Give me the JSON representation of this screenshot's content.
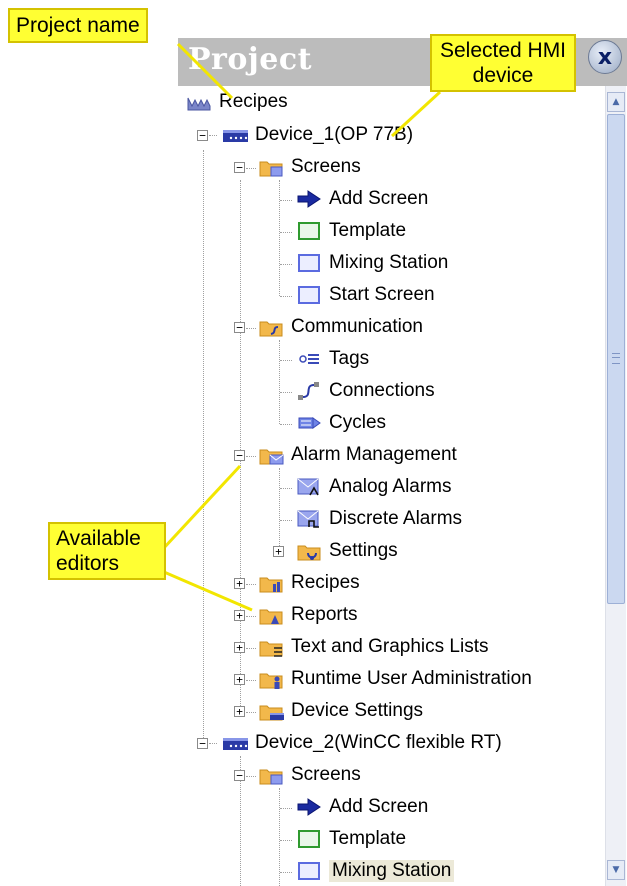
{
  "panel": {
    "title": "Project",
    "close_symbol": "x"
  },
  "scrollbar": {
    "up_glyph": "▲",
    "down_glyph": "▼"
  },
  "callouts": {
    "project_name": "Project name",
    "selected_device": "Selected HMI device",
    "available_editors": "Available editors"
  },
  "tree": {
    "root": "Recipes",
    "device1": {
      "label": "Device_1(OP 77B)",
      "screens": "Screens",
      "add_screen": "Add Screen",
      "template": "Template",
      "mixing_station": "Mixing Station",
      "start_screen": "Start Screen",
      "communication": "Communication",
      "tags": "Tags",
      "connections": "Connections",
      "cycles": "Cycles",
      "alarm_management": "Alarm Management",
      "analog_alarms": "Analog Alarms",
      "discrete_alarms": "Discrete Alarms",
      "settings": "Settings",
      "recipes": "Recipes",
      "reports": "Reports",
      "text_graphics": "Text and Graphics Lists",
      "runtime_user_admin": "Runtime User Administration",
      "device_settings": "Device Settings"
    },
    "device2": {
      "label": "Device_2(WinCC flexible RT)",
      "screens": "Screens",
      "add_screen": "Add Screen",
      "template": "Template",
      "mixing_station": "Mixing Station"
    },
    "expander_plus": "+",
    "expander_minus": "−"
  },
  "colors": {
    "callout": "#ffff33",
    "titlebar": "#bcbcbc",
    "folder": "#f2b84b",
    "screen_icon": "#6f7fe0",
    "template_icon": "#3fae3f",
    "selection": "#ece9d8"
  }
}
